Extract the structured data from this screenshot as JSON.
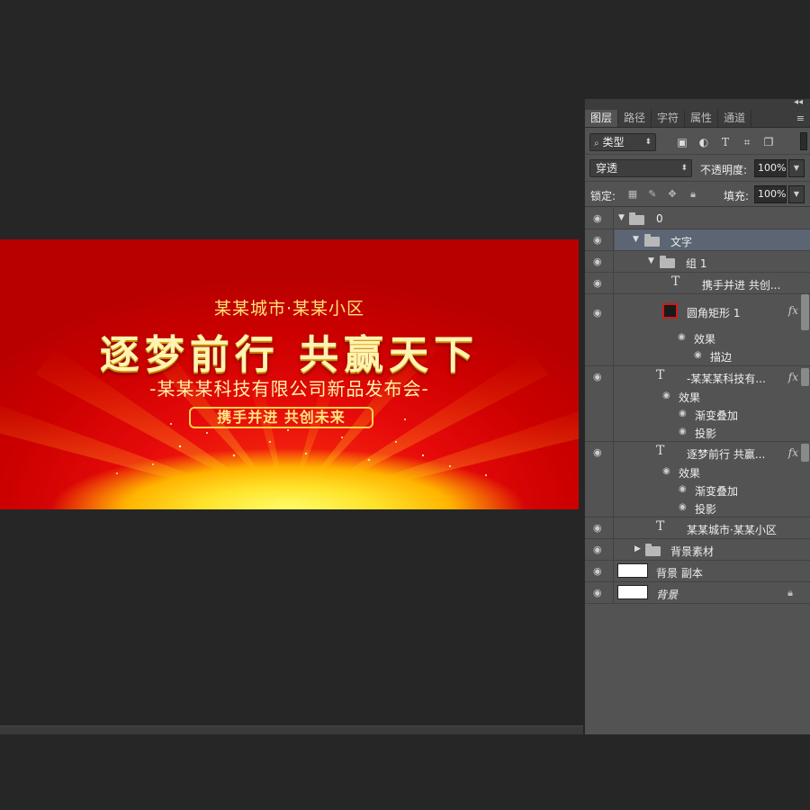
{
  "banner": {
    "subtitle": "某某城市·某某小区",
    "title": "逐梦前行 共赢天下",
    "company": "-某某某科技有限公司新品发布会-",
    "slogan": "携手并进 共创未来"
  },
  "panel": {
    "tabs": [
      "图层",
      "路径",
      "字符",
      "属性",
      "通道"
    ],
    "filter_label": "类型",
    "blend_mode": "穿透",
    "opacity_label": "不透明度:",
    "opacity_value": "100%",
    "lock_label": "锁定:",
    "fill_label": "填充:",
    "fill_value": "100%"
  },
  "layers": {
    "g0": "0",
    "text_group": "文字",
    "group1": "组 1",
    "t_slogan": "携手并进 共创...",
    "rect": "圆角矩形 1",
    "effects": "效果",
    "stroke": "描边",
    "t_company": "-某某某科技有...",
    "effects2": "效果",
    "gradient": "渐变叠加",
    "shadow": "投影",
    "t_title": "逐梦前行 共赢...",
    "effects3": "效果",
    "gradient2": "渐变叠加",
    "shadow2": "投影",
    "t_sub": "某某城市·某某小区",
    "bg_material": "背景素材",
    "bg_copy": "背景 副本",
    "bg": "背景"
  }
}
